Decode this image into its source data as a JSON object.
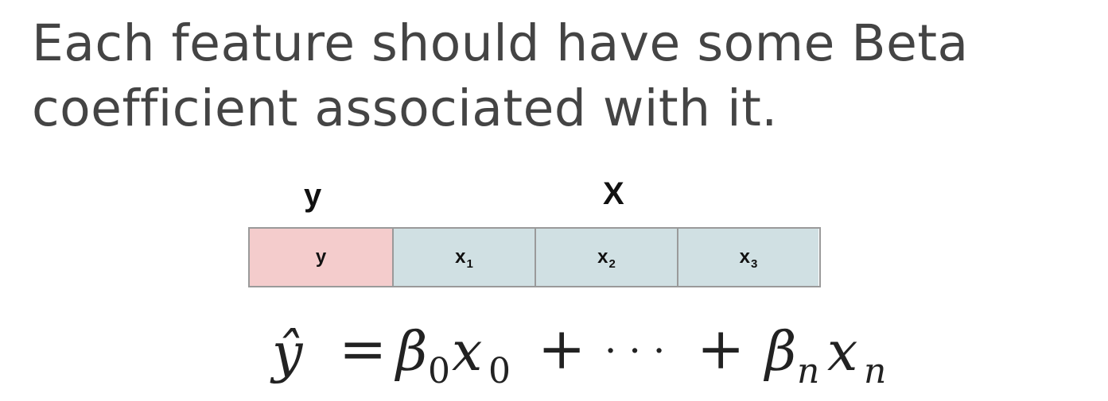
{
  "slide": {
    "title": "Each feature should have some Beta coefficient associated with it."
  },
  "diagram": {
    "header_y": "y",
    "header_x": "X",
    "cells": [
      {
        "label": "y",
        "sub": ""
      },
      {
        "label": "x",
        "sub": "1"
      },
      {
        "label": "x",
        "sub": "2"
      },
      {
        "label": "x",
        "sub": "3"
      }
    ],
    "colors": {
      "target_fill": "#f4cccc",
      "feature_fill": "#d0e0e3",
      "border": "#9a9a9a"
    }
  },
  "equation": {
    "lhs": "ŷ",
    "eq": "=",
    "beta": "β",
    "x": "x",
    "sub0": "0",
    "plus": "+",
    "dots": "· · ·",
    "subn": "n"
  }
}
